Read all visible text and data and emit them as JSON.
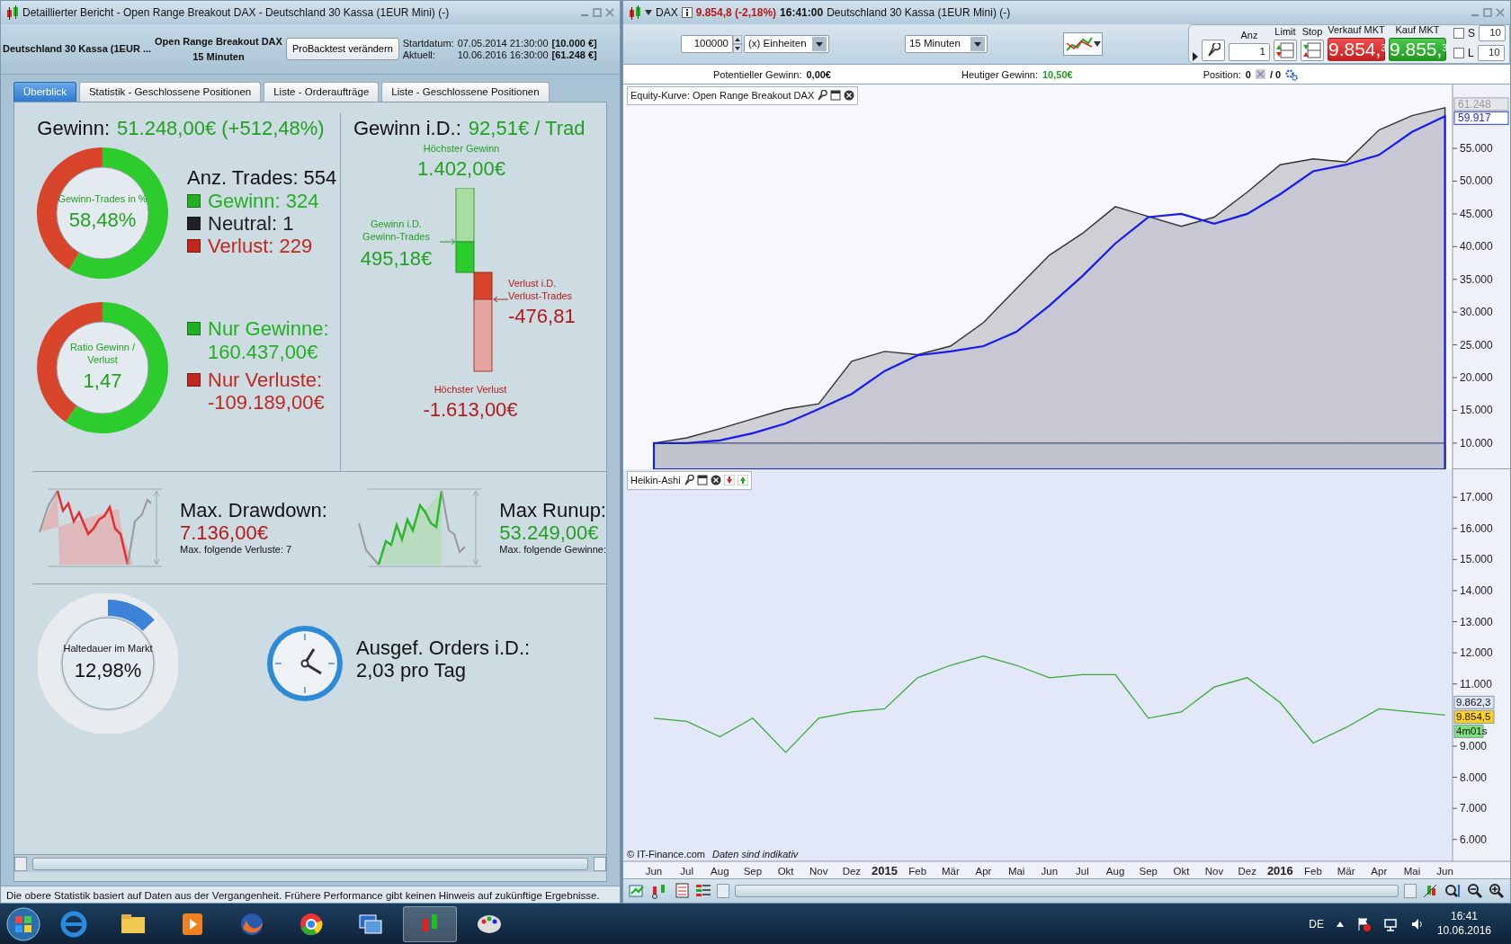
{
  "left_window": {
    "title": "Detaillierter Bericht - Open Range Breakout DAX - Deutschland 30 Kassa (1EUR Mini) (-)",
    "header": {
      "instrument": "Deutschland 30 Kassa (1EUR ...",
      "system": "Open Range Breakout DAX",
      "timeframe": "15 Minuten",
      "button": "ProBacktest verändern",
      "start_label": "Startdatum:",
      "start_date": "07.05.2014 21:30:00",
      "start_capital": "[10.000 €]",
      "current_label": "Aktuell:",
      "current_date": "10.06.2016 16:30:00",
      "current_capital": "[61.248 €]"
    },
    "tabs": [
      {
        "label": "Überblick",
        "selected": true
      },
      {
        "label": "Statistik - Geschlossene Positionen",
        "selected": false
      },
      {
        "label": "Liste - Orderaufträge",
        "selected": false
      },
      {
        "label": "Liste - Geschlossene Positionen",
        "selected": false
      }
    ],
    "overview": {
      "profit": {
        "label": "Gewinn:",
        "value": "51.248,00€ (+512,48%)"
      },
      "win_rate": {
        "caption": "Gewinn-Trades in %",
        "value": "58,48%"
      },
      "trade_count": "Anz. Trades: 554",
      "trade_types": [
        {
          "label": "Gewinn: 324",
          "color": "#22b022"
        },
        {
          "label": "Neutral: 1",
          "color": "#222222"
        },
        {
          "label": "Verlust: 229",
          "color": "#c0281e"
        }
      ],
      "ratio": {
        "caption": "Ratio Gewinn / Verlust",
        "value": "1,47"
      },
      "totals": [
        {
          "label": "Nur Gewinne:",
          "value": "160.437,00€",
          "color": "#22b022"
        },
        {
          "label": "Nur Verluste:",
          "value": "-109.189,00€",
          "color": "#c0281e"
        }
      ],
      "daily": {
        "label": "Gewinn i.D.:",
        "value": "92,51€ / Trad",
        "max_gain_label": "Höchster Gewinn",
        "max_gain": "1.402,00€",
        "avg_gain_label": "Gewinn i.D. Gewinn-Trades",
        "avg_gain": "495,18€",
        "avg_loss_label": "Verlust i.D. Verlust-Trades",
        "avg_loss": "-476,81",
        "max_loss_label": "Höchster Verlust",
        "max_loss": "-1.613,00€"
      },
      "drawdown": {
        "label": "Max. Drawdown:",
        "value": "7.136,00€",
        "note": "Max. folgende Verluste: 7"
      },
      "runup": {
        "label": "Max Runup:",
        "value": "53.249,00€",
        "note": "Max. folgende Gewinne:"
      },
      "holding": {
        "caption": "Haltedauer im Markt",
        "value": "12,98%",
        "level": 0.1298
      },
      "orders": {
        "label": "Ausgef. Orders i.D.:",
        "value": "2,03 pro Tag"
      }
    },
    "status_bar": "Die obere Statistik basiert auf Daten aus der Vergangenheit. Frühere Performance gibt keinen Hinweis auf zukünftige Ergebnisse."
  },
  "right_window": {
    "symbol": "DAX",
    "quote": "9.854,8 (-2,18%)",
    "time": "16:41:00",
    "instrument": "Deutschland 30 Kassa (1EUR Mini) (-)",
    "toolbar": {
      "quantity": "100000",
      "unit": "(x) Einheiten",
      "interval": "15 Minuten",
      "anz_label": "Anz",
      "anz": "1",
      "limit_label": "Limit",
      "stop_label": "Stop",
      "sell_label": "Verkauf MKT",
      "sell_price": "9.854,$^{3}$",
      "buy_label": "Kauf MKT",
      "buy_price": "9.855,$^{3}$",
      "checks": [
        {
          "label": "S",
          "checked": false,
          "value": "10"
        },
        {
          "label": "L",
          "checked": false,
          "value": "10"
        }
      ]
    },
    "info": {
      "potential_label": "Potentieller Gewinn:",
      "potential": "0,00€",
      "today_label": "Heutiger Gewinn:",
      "today": "10,50€",
      "position_label": "Position:",
      "position_long": "0",
      "position_short": "/ 0"
    },
    "equity_pane": {
      "title": "Equity-Kurve: Open Range Breakout DAX",
      "chart_data": {
        "type": "area",
        "ylim": [
          6000,
          64750
        ],
        "yticks": [
          {
            "value": 10000,
            "label": "10.000"
          },
          {
            "value": 15000,
            "label": "15.000"
          },
          {
            "value": 20000,
            "label": "20.000"
          },
          {
            "value": 25000,
            "label": "25.000"
          },
          {
            "value": 30000,
            "label": "30.000"
          },
          {
            "value": 35000,
            "label": "35.000"
          },
          {
            "value": 40000,
            "label": "40.000"
          },
          {
            "value": 45000,
            "label": "45.000"
          },
          {
            "value": 50000,
            "label": "50.000"
          },
          {
            "value": 55000,
            "label": "55.000"
          }
        ],
        "series": [
          {
            "color": "#333333",
            "values": [
              10000,
              10800,
              12200,
              13700,
              15200,
              16000,
              22500,
              24000,
              23500,
              24800,
              28400,
              33600,
              38700,
              42000,
              46100,
              44600,
              43100,
              44500,
              48300,
              52500,
              53400,
              52900,
              57800,
              60000,
              61200
            ]
          },
          {
            "color": "#1a1aee",
            "values": [
              10000,
              10000,
              10400,
              11500,
              13000,
              15200,
              17500,
              21000,
              23400,
              24000,
              24800,
              27000,
              31000,
              35500,
              40500,
              44500,
              45000,
              43500,
              45000,
              48000,
              51500,
              52500,
              54000,
              57500,
              59900
            ]
          },
          {
            "color": "#22336a",
            "values": [
              10000,
              10000,
              10000,
              10000,
              10000,
              10000,
              10000,
              10000,
              10000,
              10000,
              10000,
              10000,
              10000,
              10000,
              10000,
              10000,
              10000,
              10000,
              10000,
              10000,
              10000,
              10000,
              10000,
              10000,
              10000
            ]
          }
        ]
      },
      "tags": [
        "61.248",
        "59.917"
      ]
    },
    "price_pane": {
      "title": "Heikin-Ashi",
      "chart_data": {
        "type": "line",
        "ylim": [
          5300,
          17900
        ],
        "categories": [
          "Jun",
          "Jul",
          "Aug",
          "Sep",
          "Okt",
          "Nov",
          "Dez",
          "2015",
          "Feb",
          "Mär",
          "Apr",
          "Mai",
          "Jun",
          "Jul",
          "Aug",
          "Sep",
          "Okt",
          "Nov",
          "Dez",
          "2016",
          "Feb",
          "Mär",
          "Apr",
          "Mai",
          "Jun"
        ],
        "yticks": [
          {
            "value": 6000,
            "label": "6.000"
          },
          {
            "value": 7000,
            "label": "7.000"
          },
          {
            "value": 8000,
            "label": "8.000"
          },
          {
            "value": 9000,
            "label": "9.000"
          },
          {
            "value": 11000,
            "label": "11.000"
          },
          {
            "value": 12000,
            "label": "12.000"
          },
          {
            "value": 13000,
            "label": "13.000"
          },
          {
            "value": 14000,
            "label": "14.000"
          },
          {
            "value": 15000,
            "label": "15.000"
          },
          {
            "value": 16000,
            "label": "16.000"
          },
          {
            "value": 17000,
            "label": "17.000"
          }
        ],
        "series": [
          {
            "color": "#3aa83a",
            "values": [
              9900,
              9800,
              9300,
              9900,
              8800,
              9900,
              10100,
              10200,
              11200,
              11600,
              11900,
              11600,
              11200,
              11300,
              11300,
              9900,
              10100,
              10900,
              11200,
              10400,
              9100,
              9600,
              10200,
              10100,
              10000
            ]
          }
        ]
      },
      "tags": [
        {
          "label": "9.862,3",
          "color": "#dde4f4"
        },
        {
          "label": "9.854,5",
          "color": "#ffd21e"
        },
        {
          "label": "4m01s",
          "color": "#7ee07e"
        }
      ],
      "source": "© IT-Finance.com",
      "disclaimer": "Daten sind indikativ"
    }
  },
  "taskbar": {
    "language": "DE",
    "time": "16:41",
    "date": "10.06.2016"
  }
}
